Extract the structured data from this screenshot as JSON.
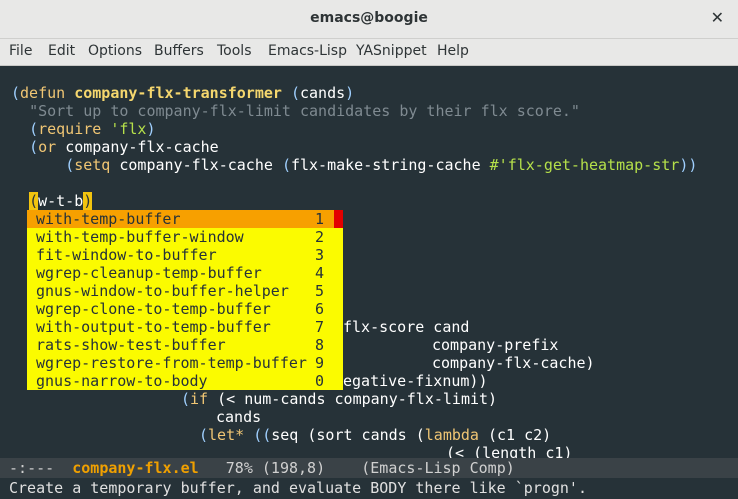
{
  "window": {
    "title": "emacs@boogie",
    "close_glyph": "✕"
  },
  "menu": [
    "File",
    "Edit",
    "Options",
    "Buffers",
    "Tools",
    "Emacs-Lisp",
    "YASnippet",
    "Help"
  ],
  "code": {
    "l1_kw": "defun",
    "l1_fn": "company-flx-transformer",
    "l1_arg": "cands",
    "l2_str": "\"Sort up to company-flx-limit candidates by their flx score.\"",
    "l3_kw": "require",
    "l3_sym": "'flx",
    "l4_kw": "or",
    "l4_text": "company-flx-cache",
    "l5_kw": "setq",
    "l5_text": "company-flx-cache",
    "l5_call": "flx-make-string-cache",
    "l5_sym": "#'flx-get-heatmap-str",
    "l6_text": "w-t-b",
    "r1": "flx-score cand",
    "r2": "company-prefix",
    "r3": "company-flx-cache)",
    "r4": "egative-fixnum))",
    "l7_kw": "if",
    "l7_text": "(< num-cands company-flx-limit)",
    "l8_text": "cands",
    "l9_kw": "let*",
    "l9_text": "seq (sort cands (",
    "l9_kw2": "lambda",
    "l9_tail": "(c1 c2)",
    "l10_text": "(< (length c1)"
  },
  "completions": [
    {
      "name": "with-temp-buffer",
      "num": "1"
    },
    {
      "name": "with-temp-buffer-window",
      "num": "2"
    },
    {
      "name": "fit-window-to-buffer",
      "num": "3"
    },
    {
      "name": "wgrep-cleanup-temp-buffer",
      "num": "4"
    },
    {
      "name": "gnus-window-to-buffer-helper",
      "num": "5"
    },
    {
      "name": "wgrep-clone-to-temp-buffer",
      "num": "6"
    },
    {
      "name": "with-output-to-temp-buffer",
      "num": "7"
    },
    {
      "name": "rats-show-test-buffer",
      "num": "8"
    },
    {
      "name": "wgrep-restore-from-temp-buffer",
      "num": "9"
    },
    {
      "name": "gnus-narrow-to-body",
      "num": "0"
    }
  ],
  "modeline": {
    "prefix": " -:---  ",
    "buffer": "company-flx.el",
    "position": "   78% (198,8)    (Emacs-Lisp Comp)"
  },
  "echo": "Create a temporary buffer, and evaluate BODY there like `progn'."
}
